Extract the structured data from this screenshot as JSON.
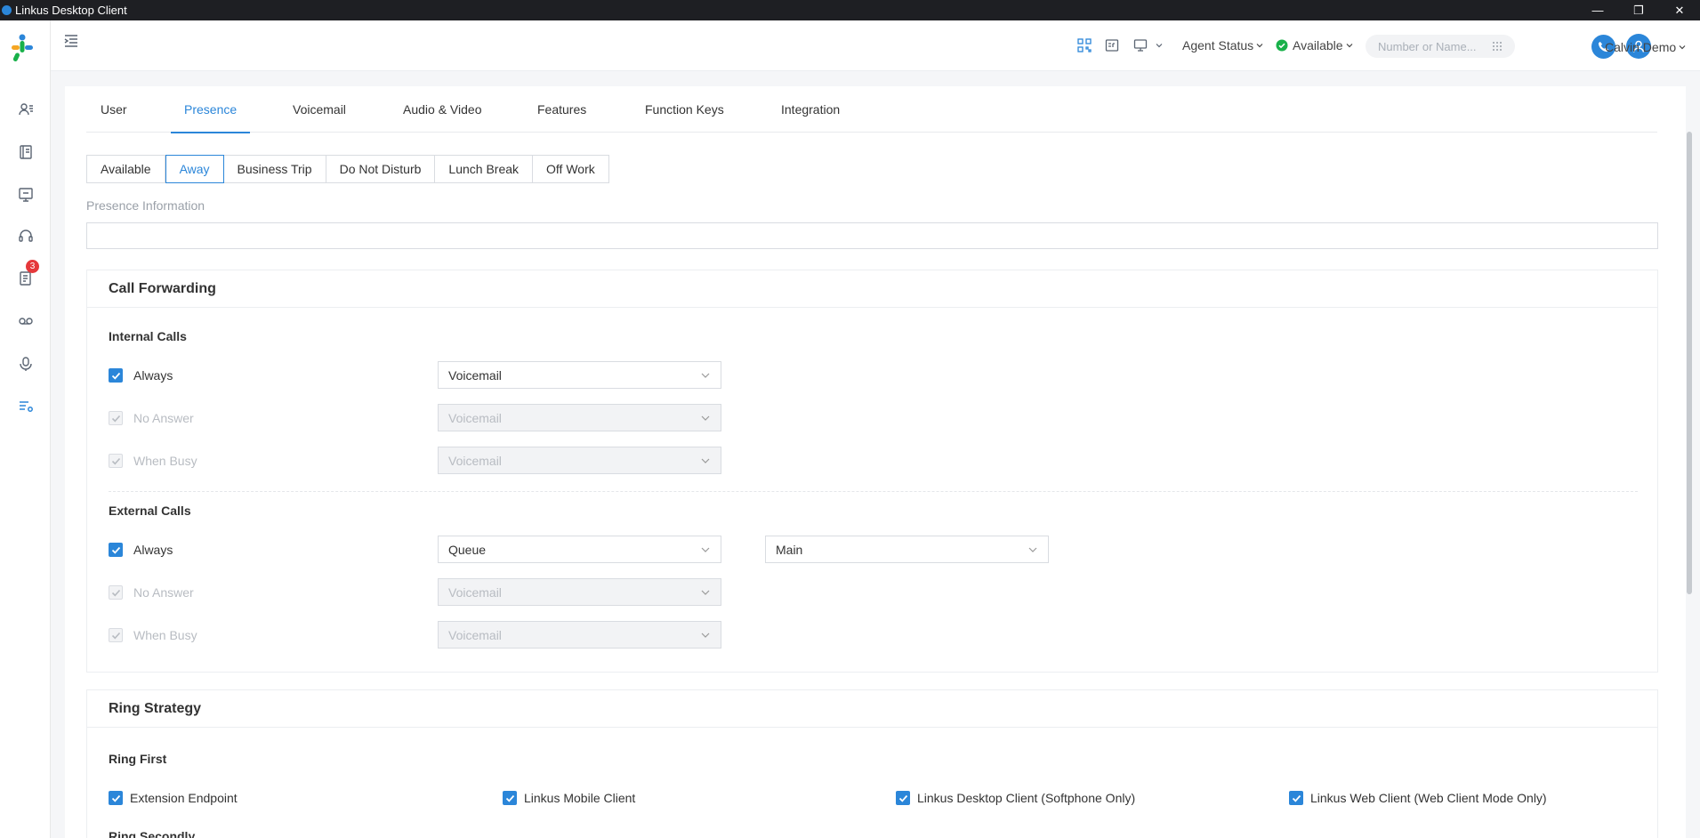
{
  "window": {
    "title": "Linkus Desktop Client",
    "controls": [
      "—",
      "❐",
      "✕"
    ]
  },
  "sidebar": {
    "items": [
      {
        "name": "contacts",
        "icon": "contacts-icon"
      },
      {
        "name": "phonebook",
        "icon": "phonebook-icon"
      },
      {
        "name": "meeting",
        "icon": "conference-icon"
      },
      {
        "name": "call-center",
        "icon": "headset-icon"
      },
      {
        "name": "call-log",
        "icon": "call-log-icon",
        "badge": "3"
      },
      {
        "name": "voicemail",
        "icon": "voicemail-icon"
      },
      {
        "name": "recording",
        "icon": "microphone-icon"
      },
      {
        "name": "preferences",
        "icon": "settings-list-icon"
      }
    ]
  },
  "header": {
    "agent_status": "Agent Status",
    "presence_status": "Available",
    "search_placeholder": "Number or Name...",
    "user_name": "Calvin Demo"
  },
  "tabs": [
    "User",
    "Presence",
    "Voicemail",
    "Audio & Video",
    "Features",
    "Function Keys",
    "Integration"
  ],
  "active_tab": "Presence",
  "presence": {
    "states": [
      "Available",
      "Away",
      "Business Trip",
      "Do Not Disturb",
      "Lunch Break",
      "Off Work"
    ],
    "active_state": "Away",
    "info_label": "Presence Information",
    "info_value": ""
  },
  "call_forwarding": {
    "title": "Call Forwarding",
    "internal": {
      "title": "Internal Calls",
      "always": {
        "label": "Always",
        "value": "Voicemail"
      },
      "no_answer": {
        "label": "No Answer",
        "value": "Voicemail"
      },
      "when_busy": {
        "label": "When Busy",
        "value": "Voicemail"
      }
    },
    "external": {
      "title": "External Calls",
      "always": {
        "label": "Always",
        "value": "Queue",
        "target": "Main"
      },
      "no_answer": {
        "label": "No Answer",
        "value": "Voicemail"
      },
      "when_busy": {
        "label": "When Busy",
        "value": "Voicemail"
      }
    }
  },
  "ring_strategy": {
    "title": "Ring Strategy",
    "ring_first": {
      "title": "Ring First",
      "options": [
        "Extension Endpoint",
        "Linkus Mobile Client",
        "Linkus Desktop Client (Softphone Only)",
        "Linkus Web Client (Web Client Mode Only)"
      ]
    },
    "ring_secondly": {
      "title": "Ring Secondly"
    }
  },
  "colors": {
    "accent": "#2b86d9",
    "badge": "#e5383b",
    "status_green": "#19b14a",
    "titlebar": "#1e1f23"
  }
}
